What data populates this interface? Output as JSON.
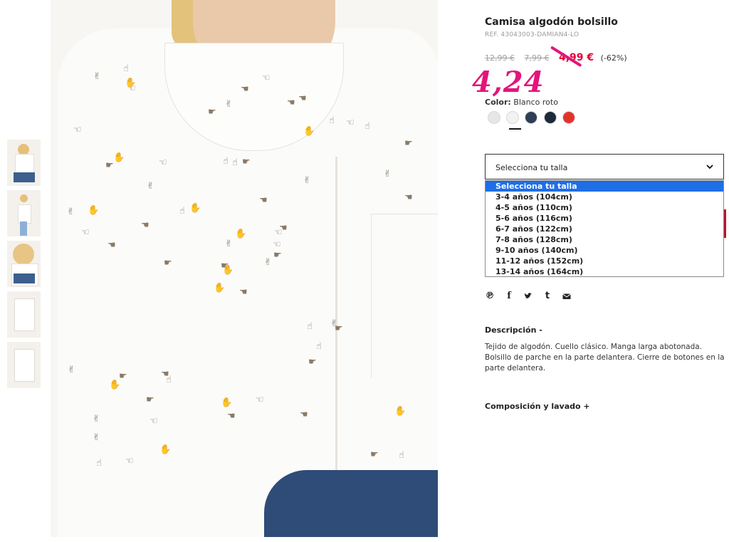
{
  "product": {
    "title": "Camisa algodón bolsillo",
    "ref": "REF. 43043003-DAMIAN4-LO",
    "price_original": "12,99 €",
    "price_previous": "7,99 €",
    "price_sale": "4,99 €",
    "discount": "(-62%)",
    "handwritten_price": "4,24"
  },
  "color": {
    "label": "Color:",
    "value": "Blanco roto",
    "swatches": [
      {
        "name": "light-grey",
        "hex": "#e6e6e6"
      },
      {
        "name": "white-print",
        "hex": "#f2f2f2"
      },
      {
        "name": "navy-print",
        "hex": "#2e3f55"
      },
      {
        "name": "dark-navy",
        "hex": "#1d2a3a"
      },
      {
        "name": "red",
        "hex": "#e2332b"
      }
    ],
    "selected_index": 1
  },
  "size_select": {
    "placeholder": "Selecciona tu talla",
    "options": [
      "Selecciona tu talla",
      "3-4 años (104cm)",
      "4-5 años (110cm)",
      "5-6 años (116cm)",
      "6-7 años (122cm)",
      "7-8 años (128cm)",
      "9-10 años (140cm)",
      "11-12 años (152cm)",
      "13-14 años (164cm)"
    ]
  },
  "social": [
    "pinterest-icon",
    "facebook-icon",
    "twitter-icon",
    "tumblr-icon",
    "email-icon"
  ],
  "description": {
    "title": "Descripción -",
    "text": "Tejido de algodón. Cuello clásico. Manga larga abotonada. Bolsillo de parche en la parte delantera. Cierre de botones en la parte delantera."
  },
  "composition": {
    "title": "Composición y lavado +"
  },
  "colors": {
    "accent_sale": "#e4003a",
    "annotation": "#e4147a",
    "dropdown_highlight": "#1e6fe6"
  }
}
